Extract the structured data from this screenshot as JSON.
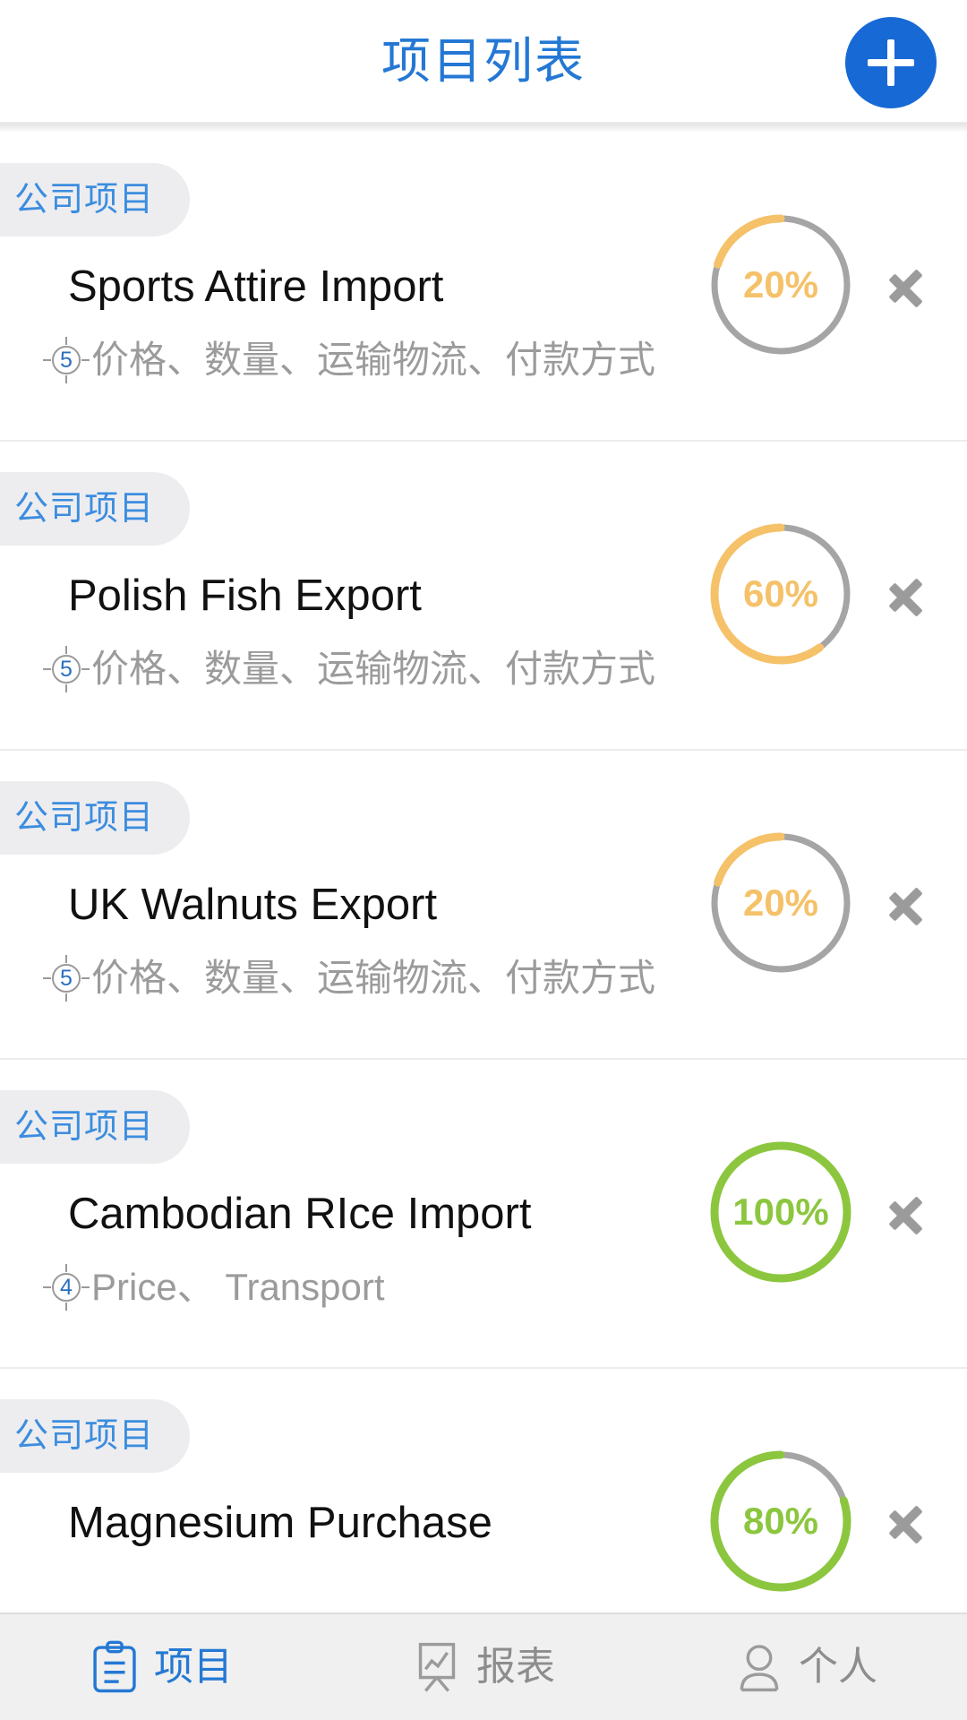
{
  "header": {
    "title": "项目列表",
    "add_button_label": "+",
    "title_color": "#2478D4",
    "fab_color": "#1769D6"
  },
  "colors": {
    "accent_blue": "#2478D4",
    "tag_blue": "#3C8DDE",
    "progress_orange": "#F5C169",
    "progress_green": "#8CC63F",
    "track_gray": "#A5A5A5",
    "subtitle_gray": "#9b9b9b"
  },
  "list": {
    "items": [
      {
        "tag": "公司项目",
        "title": "Sports Attire Import",
        "count": "5",
        "subtitle": "价格、数量、运输物流、付款方式",
        "percent": 20,
        "percent_label": "20%",
        "ring_color": "#F5C169"
      },
      {
        "tag": "公司项目",
        "title": "Polish Fish Export",
        "count": "5",
        "subtitle": "价格、数量、运输物流、付款方式",
        "percent": 60,
        "percent_label": "60%",
        "ring_color": "#F5C169"
      },
      {
        "tag": "公司项目",
        "title": "UK Walnuts Export",
        "count": "5",
        "subtitle": "价格、数量、运输物流、付款方式",
        "percent": 20,
        "percent_label": "20%",
        "ring_color": "#F5C169"
      },
      {
        "tag": "公司项目",
        "title": "Cambodian RIce Import",
        "count": "4",
        "subtitle": "Price、 Transport",
        "percent": 100,
        "percent_label": "100%",
        "ring_color": "#8CC63F"
      },
      {
        "tag": "公司项目",
        "title": "Magnesium Purchase",
        "count": "",
        "subtitle": "",
        "percent": 80,
        "percent_label": "80%",
        "ring_color": "#8CC63F"
      }
    ]
  },
  "tabbar": {
    "tabs": [
      {
        "label": "项目",
        "icon": "clipboard-icon",
        "active": true
      },
      {
        "label": "报表",
        "icon": "chart-easel-icon",
        "active": false
      },
      {
        "label": "个人",
        "icon": "person-icon",
        "active": false
      }
    ]
  }
}
